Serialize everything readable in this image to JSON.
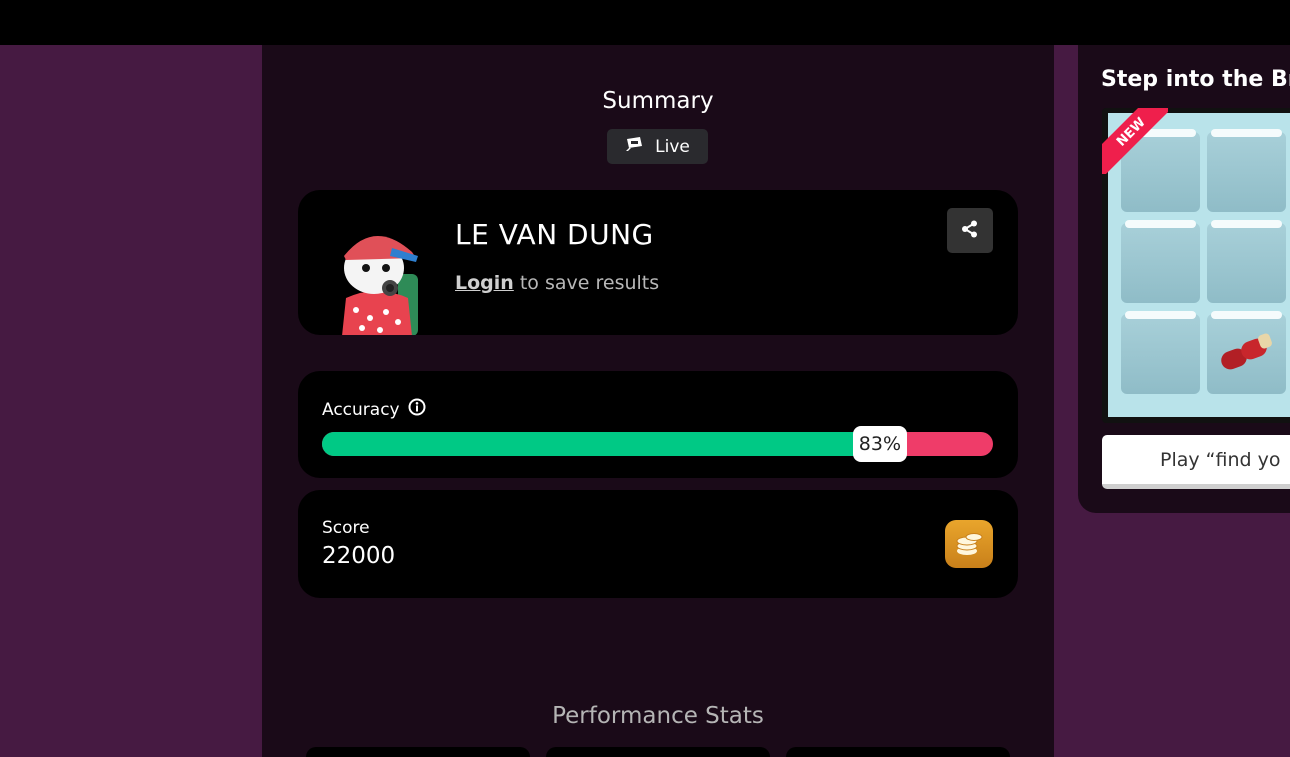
{
  "summary": {
    "title": "Summary",
    "live_label": "Live"
  },
  "player": {
    "name": "LE VAN DUNG",
    "login_link": "Login",
    "login_suffix": " to save results"
  },
  "accuracy": {
    "label": "Accuracy",
    "percent_text": "83%",
    "percent": 83
  },
  "score": {
    "label": "Score",
    "value": "22000"
  },
  "performance": {
    "title": "Performance Stats"
  },
  "promo": {
    "title": "Step into the Bro",
    "badge": "NEW",
    "button_label": "Play “find yo"
  },
  "colors": {
    "accent_green": "#00c985",
    "accent_red": "#ef3c69",
    "coin": "#e09a26",
    "background": "#461a42"
  }
}
